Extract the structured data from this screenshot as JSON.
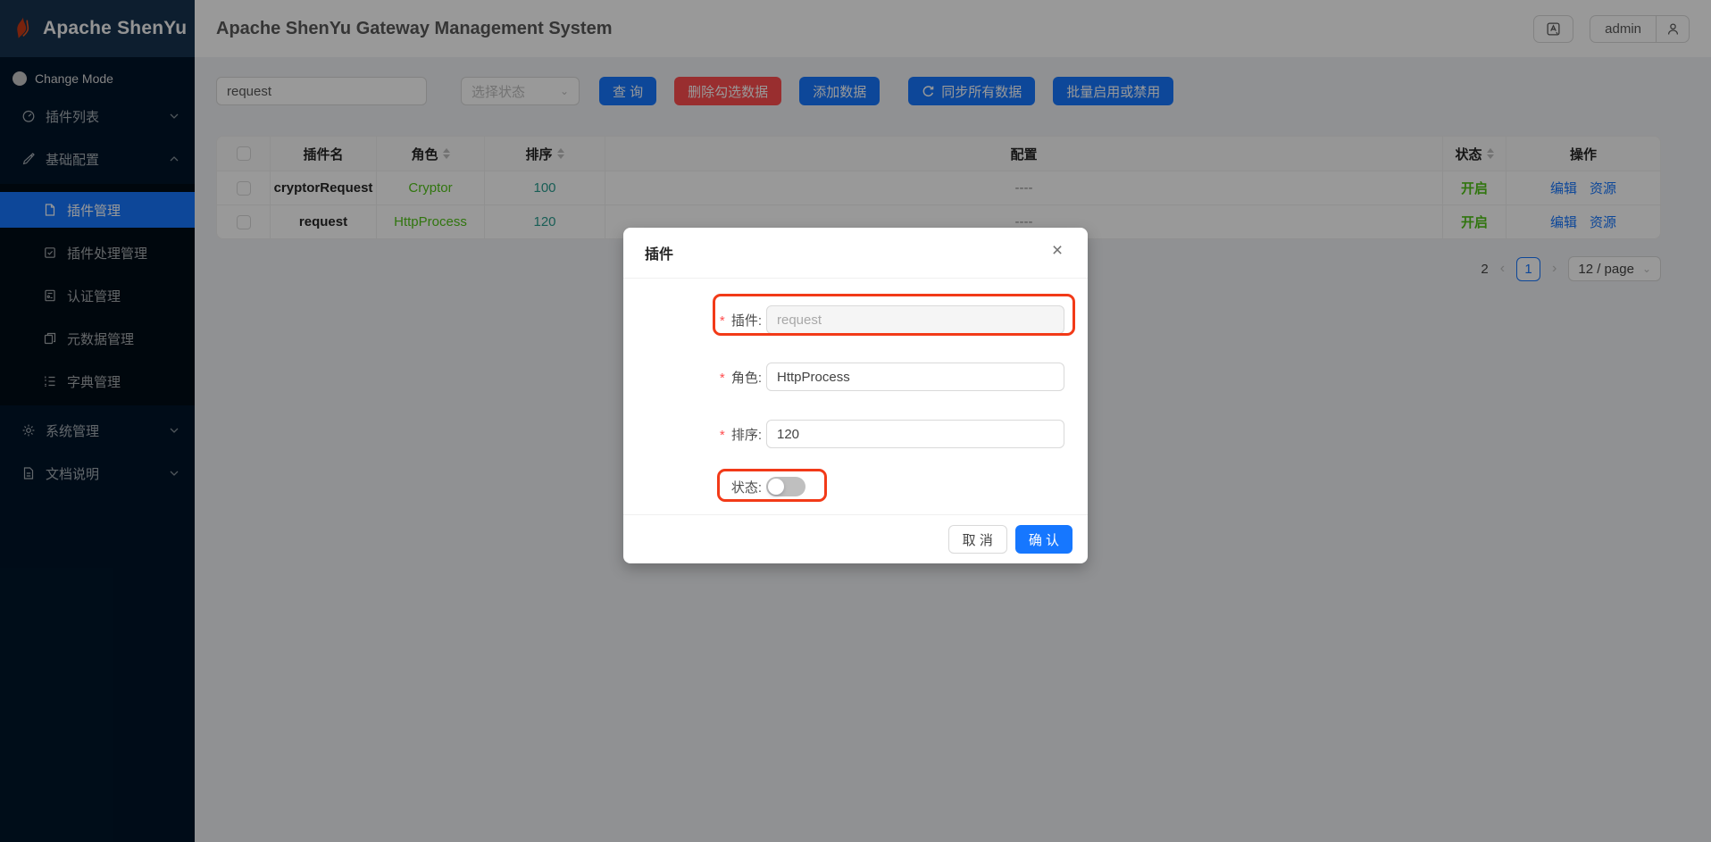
{
  "app": {
    "logo_text": "Apache ShenYu",
    "header_title": "Apache ShenYu Gateway Management System",
    "user": "admin"
  },
  "sidebar": {
    "change_mode": "Change Mode",
    "plugin_list": "插件列表",
    "basic_config": "基础配置",
    "basic_children": [
      {
        "label": "插件管理",
        "selected": true
      },
      {
        "label": "插件处理管理",
        "selected": false
      },
      {
        "label": "认证管理",
        "selected": false
      },
      {
        "label": "元数据管理",
        "selected": false
      },
      {
        "label": "字典管理",
        "selected": false
      }
    ],
    "system_admin": "系统管理",
    "docs": "文档说明"
  },
  "toolbar": {
    "search_value": "request",
    "status_placeholder": "选择状态",
    "query": "查 询",
    "delete_selected": "删除勾选数据",
    "add": "添加数据",
    "sync_all": "同步所有数据",
    "batch_toggle": "批量启用或禁用"
  },
  "table": {
    "headers": {
      "name": "插件名",
      "role": "角色",
      "sort": "排序",
      "config": "配置",
      "status": "状态",
      "ops": "操作"
    },
    "rows": [
      {
        "name": "cryptorRequest",
        "role": "Cryptor",
        "sort": "100",
        "config": "----",
        "status": "开启",
        "edit": "编辑",
        "resource": "资源"
      },
      {
        "name": "request",
        "role": "HttpProcess",
        "sort": "120",
        "config": "----",
        "status": "开启",
        "edit": "编辑",
        "resource": "资源"
      }
    ]
  },
  "pagination": {
    "total": "2",
    "prev": "‹",
    "current": "1",
    "next": "›",
    "page_size": "12 / page"
  },
  "modal": {
    "title": "插件",
    "close_icon": "×",
    "required_mark": "*",
    "fields": {
      "plugin": {
        "label": "插件:",
        "value": "request",
        "disabled": true
      },
      "role": {
        "label": "角色:",
        "value": "HttpProcess"
      },
      "sort": {
        "label": "排序:",
        "value": "120"
      },
      "status": {
        "label": "状态:",
        "switch_on": false
      }
    },
    "cancel": "取 消",
    "confirm": "确 认"
  },
  "icons": {
    "select_arrow": "⌄",
    "size_arrow": "⌄"
  },
  "colors": {
    "primary": "#1677ff",
    "danger": "#ff4d4f",
    "status_green": "#52c41a",
    "sort_teal": "#2a9d8f",
    "sidebar_bg": "#001529",
    "sidebar_selected": "#1677ff",
    "annotation_red": "#f23a18",
    "mask": "rgba(0,0,0,0.40)"
  }
}
